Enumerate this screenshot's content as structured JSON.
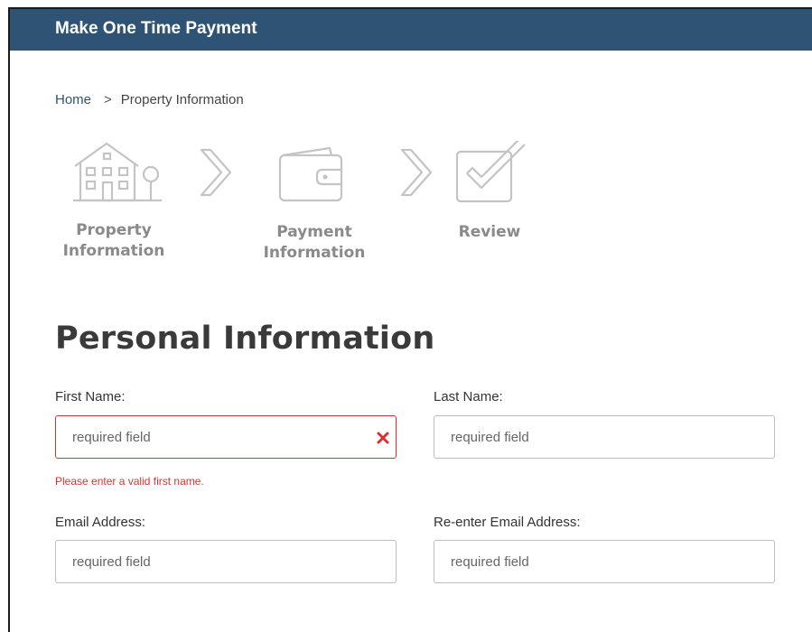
{
  "header": {
    "title": "Make One Time Payment"
  },
  "breadcrumb": {
    "home": "Home",
    "separator": ">",
    "current": "Property Information"
  },
  "steps": [
    {
      "line1": "Property",
      "line2": "Information",
      "icon": "house-icon"
    },
    {
      "line1": "Payment",
      "line2": "Information",
      "icon": "wallet-icon"
    },
    {
      "line1": "Review",
      "line2": "",
      "icon": "checkbox-icon"
    }
  ],
  "section": {
    "title": "Personal Information"
  },
  "form": {
    "first_name": {
      "label": "First Name:",
      "placeholder": "required field",
      "value": "",
      "error": "Please enter a valid first name."
    },
    "last_name": {
      "label": "Last Name:",
      "placeholder": "required field",
      "value": ""
    },
    "email": {
      "label": "Email Address:",
      "placeholder": "required field",
      "value": ""
    },
    "email_confirm": {
      "label": "Re-enter Email Address:",
      "placeholder": "required field",
      "value": ""
    }
  },
  "colors": {
    "header_bg": "#2e5374",
    "error": "#d93131",
    "step_inactive": "#b8b8b8"
  }
}
